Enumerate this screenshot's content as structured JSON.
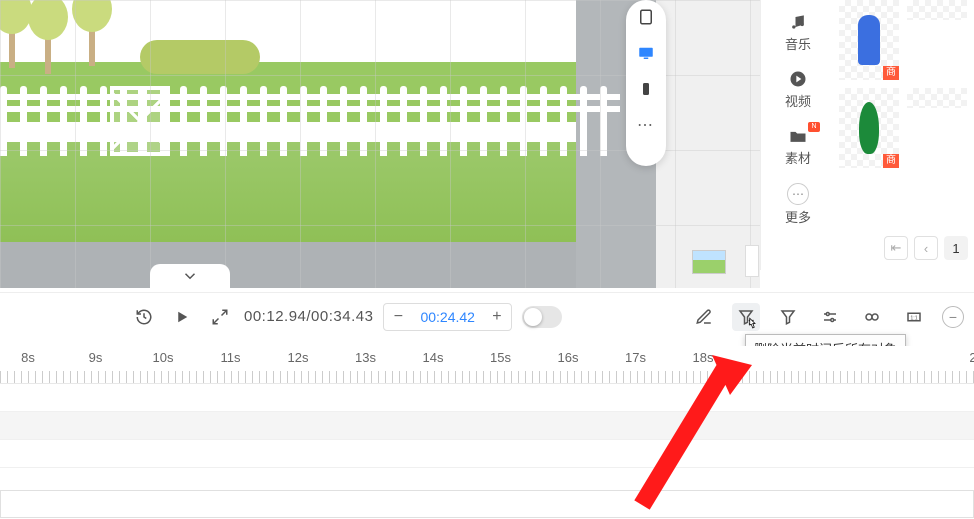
{
  "panel_nav": {
    "music": "音乐",
    "video": "视频",
    "material": "素材",
    "more": "更多",
    "new_badge": "N"
  },
  "asset_tag": "商",
  "pager": {
    "page": "1"
  },
  "toolbar": {
    "time_position": "00:12.94/00:34.43",
    "zoom_value": "00:24.42"
  },
  "tooltip": "删除当前时间后所有对象",
  "ruler": {
    "labels": [
      "8s",
      "9s",
      "10s",
      "11s",
      "12s",
      "13s",
      "14s",
      "15s",
      "16s",
      "17s",
      "18s",
      "",
      "",
      "",
      "2"
    ],
    "start": 28,
    "step": 67.5
  }
}
